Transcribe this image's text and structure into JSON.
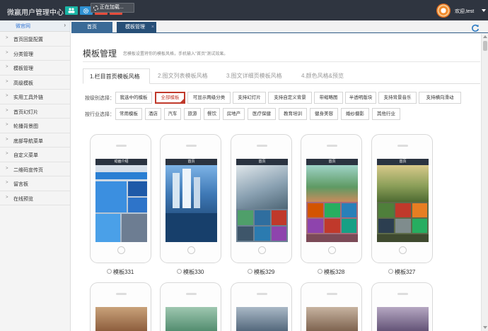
{
  "app": {
    "title": "微赢用户管理中心",
    "loading_text": "正在加载...",
    "user_welcome": "欢迎,test",
    "colors": {
      "topbar": "#2f3540",
      "btn1": "#19b5a5",
      "btn2": "#2e90d1",
      "btn3": "#e64c3c",
      "btn4": "#e64c3c"
    }
  },
  "sidebar": {
    "header": "微官网",
    "items": [
      {
        "label": "首页回复配置"
      },
      {
        "label": "分类管理"
      },
      {
        "label": "模板管理"
      },
      {
        "label": "高级模板"
      },
      {
        "label": "实用工具外链"
      },
      {
        "label": "首页幻灯片"
      },
      {
        "label": "轮播背景图"
      },
      {
        "label": "底部导航菜单"
      },
      {
        "label": "自定义菜单"
      },
      {
        "label": "二维码宣传页"
      },
      {
        "label": "留言板"
      },
      {
        "label": "在线预览"
      }
    ]
  },
  "tabs": {
    "home": "首页",
    "template": "模板管理",
    "close": "×"
  },
  "page": {
    "title": "模板管理",
    "subtitle": "您模板设置将你的模板风格，手机输入\"首页\"测试效果。",
    "steps": [
      {
        "label": "1.栏目首页模板风格"
      },
      {
        "label": "2.图文列表模板风格"
      },
      {
        "label": "3.图文详细页模板风格"
      },
      {
        "label": "4.颜色风格&预览"
      }
    ]
  },
  "filters": {
    "by_type": {
      "label": "按级别选择：",
      "options": [
        "我选中的模板",
        "全部模板",
        "可显示两级分类",
        "支持幻灯片",
        "支持自定义背景",
        "带缩略图",
        "半透明版块",
        "支持背景音乐",
        "支持横向滑动"
      ],
      "selected": "全部模板"
    },
    "by_industry": {
      "label": "按行业选择：",
      "options": [
        "常用模板",
        "酒店",
        "汽车",
        "旅游",
        "餐饮",
        "房地产",
        "医疗保健",
        "教育培训",
        "健身美容",
        "婚纱摄影",
        "其他行业"
      ]
    }
  },
  "templates": [
    {
      "name": "模板331",
      "screen_title": "动画介绍"
    },
    {
      "name": "模板330",
      "screen_title": "首页"
    },
    {
      "name": "模板329",
      "screen_title": "首页"
    },
    {
      "name": "模板328",
      "screen_title": "首页"
    },
    {
      "name": "模板327",
      "screen_title": "首页"
    }
  ]
}
